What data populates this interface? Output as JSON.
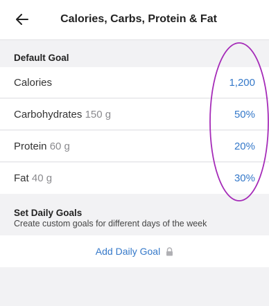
{
  "header": {
    "title": "Calories, Carbs, Protein & Fat",
    "back_icon": "arrow-left-icon"
  },
  "default_goal": {
    "title": "Default Goal",
    "rows": [
      {
        "label": "Calories",
        "amount": "",
        "value": "1,200"
      },
      {
        "label": "Carbohydrates",
        "amount": "150 g",
        "value": "50%"
      },
      {
        "label": "Protein",
        "amount": "60 g",
        "value": "20%"
      },
      {
        "label": "Fat",
        "amount": "40 g",
        "value": "30%"
      }
    ]
  },
  "daily_goals": {
    "title": "Set Daily Goals",
    "subtitle": "Create custom goals for different days of the week",
    "add_label": "Add Daily Goal",
    "add_icon": "lock-icon"
  },
  "colors": {
    "accent": "#3478c9",
    "annotation": "#a52bb8",
    "background": "#f2f2f4"
  }
}
